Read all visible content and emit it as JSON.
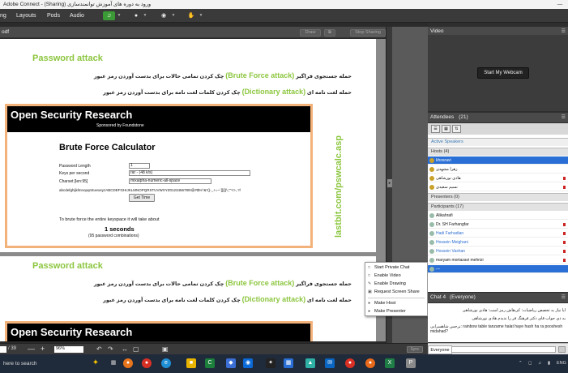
{
  "window": {
    "title": "Adobe Connect - (Sharing) ورود به دوره های آموزش توانمندسازی",
    "minimize": "—"
  },
  "menu": {
    "items": [
      "ng",
      "Layouts",
      "Pods",
      "Audio"
    ]
  },
  "share_pod": {
    "label": "odf",
    "draw": "Draw",
    "stop_sharing": "Stop Sharing"
  },
  "slide1": {
    "heading": "Password attack",
    "line1_ar": "حمله جستجوی فراگیر",
    "line1_en": "(Brute Force attack)",
    "line1_desc": "چک کردن تمامی حالات برای بدست آوردن رمز عبور",
    "line2_ar": "حمله لغت نامه ای",
    "line2_en": "(Dictionary attack)",
    "line2_desc": "چک کردن کلمات لغت نامه برای بدست آوردن رمز عبور",
    "osr_title": "Open Security Research",
    "osr_sub": "Sponsored by Foundstone",
    "bfc_title": "Brute Force Calculator",
    "pw_len_label": "Password Length",
    "pw_len_value": "1",
    "keys_label": "Keys per second",
    "keys_value": "rar - (48 k/s)",
    "charset_label": "Charset [len:95]",
    "charset_value": "mixalpha-numeric-all-space",
    "charset_chars": "abcdefghijklmnopqrstuvwxyzABCDEFGHIJKLMNOPQRSTUVWXYZ0123456789!@#$%^&*()-_+=~`[]{}|\\:;\"'<>,.?/",
    "get_time": "Get Time",
    "result_intro": "To brute force the entire keyspace it will take about",
    "result_value": "1 seconds",
    "result_combos": "(95 password combinations)",
    "vertical_url": "lastbit.com/pswcalc.asp"
  },
  "slide2": {
    "heading": "Password attack",
    "line1_ar": "حمله جستجوی فراگیر",
    "line1_en": "(Brute Force attack)",
    "line1_desc": "چک کردن تمامی حالات برای بدست آوردن رمز عبور",
    "line2_ar": "حمله لغت نامه ای",
    "line2_en": "(Dictionary attack)",
    "line2_desc": "چک کردن کلمات لغت نامه برای بدست آوردن رمز عبور",
    "osr_title": "Open Security Research"
  },
  "context_menu": {
    "items": [
      "Start Private Chat",
      "Enable Video",
      "Enable Drawing",
      "Request Screen Share",
      "Make Host",
      "Make Presenter"
    ]
  },
  "statusbar": {
    "page_total": "/ 39",
    "zoom": "96%",
    "sync": "Sync"
  },
  "video_pod": {
    "title": "Video",
    "webcam_button": "Start My Webcam"
  },
  "attendees": {
    "title": "Attendees",
    "count": "(21)",
    "active_speakers": "Active Speakers",
    "hosts_label": "Hosts (4)",
    "hosts": [
      "khosravi",
      "زهرا مشهدی",
      "هادی نورشاهی",
      "نسیم سعیدی"
    ],
    "presenters_label": "Presenters (0)",
    "participants_label": "Participants (17)",
    "participants": [
      "Alikahrafi",
      "Dr. SH Farhangfar",
      "Hadi Farhadian",
      "Hossein Meighani",
      "Hossein Vashan",
      "maryam mortazavi mehrizi",
      "—"
    ]
  },
  "chat": {
    "title": "Chat",
    "count": "4",
    "scope": "(Everyone)",
    "msg1": "ایا نیاز به تخصص ریاضیات: کی‌هاش رمز است: هادی نورشاهی",
    "msg2": "به دی جواب قای دکتر فرهنگ فر را ندیدم هادی نورشاهی",
    "msg3": "نرجس شاهسرایی: rainbow table tanzame halat haye hash ha ra pooshesh midahad?",
    "tab": "Everyone"
  },
  "taskbar": {
    "search": "here to search",
    "lang": "ENG"
  }
}
